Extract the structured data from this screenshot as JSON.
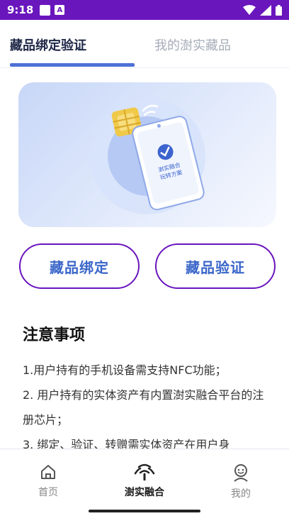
{
  "status_bar": {
    "time": "9:18",
    "a_icon_text": "A",
    "icons": [
      "wifi-icon",
      "signal-icon",
      "battery-icon"
    ],
    "background": "#6a16bd"
  },
  "tabs": [
    {
      "label": "藏品绑定验证",
      "active": true
    },
    {
      "label": "我的澍实藏品",
      "active": false
    }
  ],
  "hero": {
    "phone_screen_text": "澍实融合\n玩转方案",
    "icons": [
      "nfc-chip-icon",
      "phone-icon",
      "check-icon"
    ]
  },
  "actions": {
    "bind_label": "藏品绑定",
    "verify_label": "藏品验证",
    "border_color": "#6a16bd",
    "text_color": "#3a66c9"
  },
  "notice": {
    "title": "注意事项",
    "items": [
      "1.用户持有的手机设备需支持NFC功能；",
      "2. 用户持有的实体资产有内置澍实融合平台的注册芯片；",
      "3. 绑定、验证、转赠需实体资产在用户身"
    ]
  },
  "bottom_nav": [
    {
      "label": "首页",
      "icon": "home-icon",
      "active": false
    },
    {
      "label": "澍实融合",
      "icon": "broadcast-icon",
      "active": true
    },
    {
      "label": "我的",
      "icon": "profile-icon",
      "active": false
    }
  ]
}
